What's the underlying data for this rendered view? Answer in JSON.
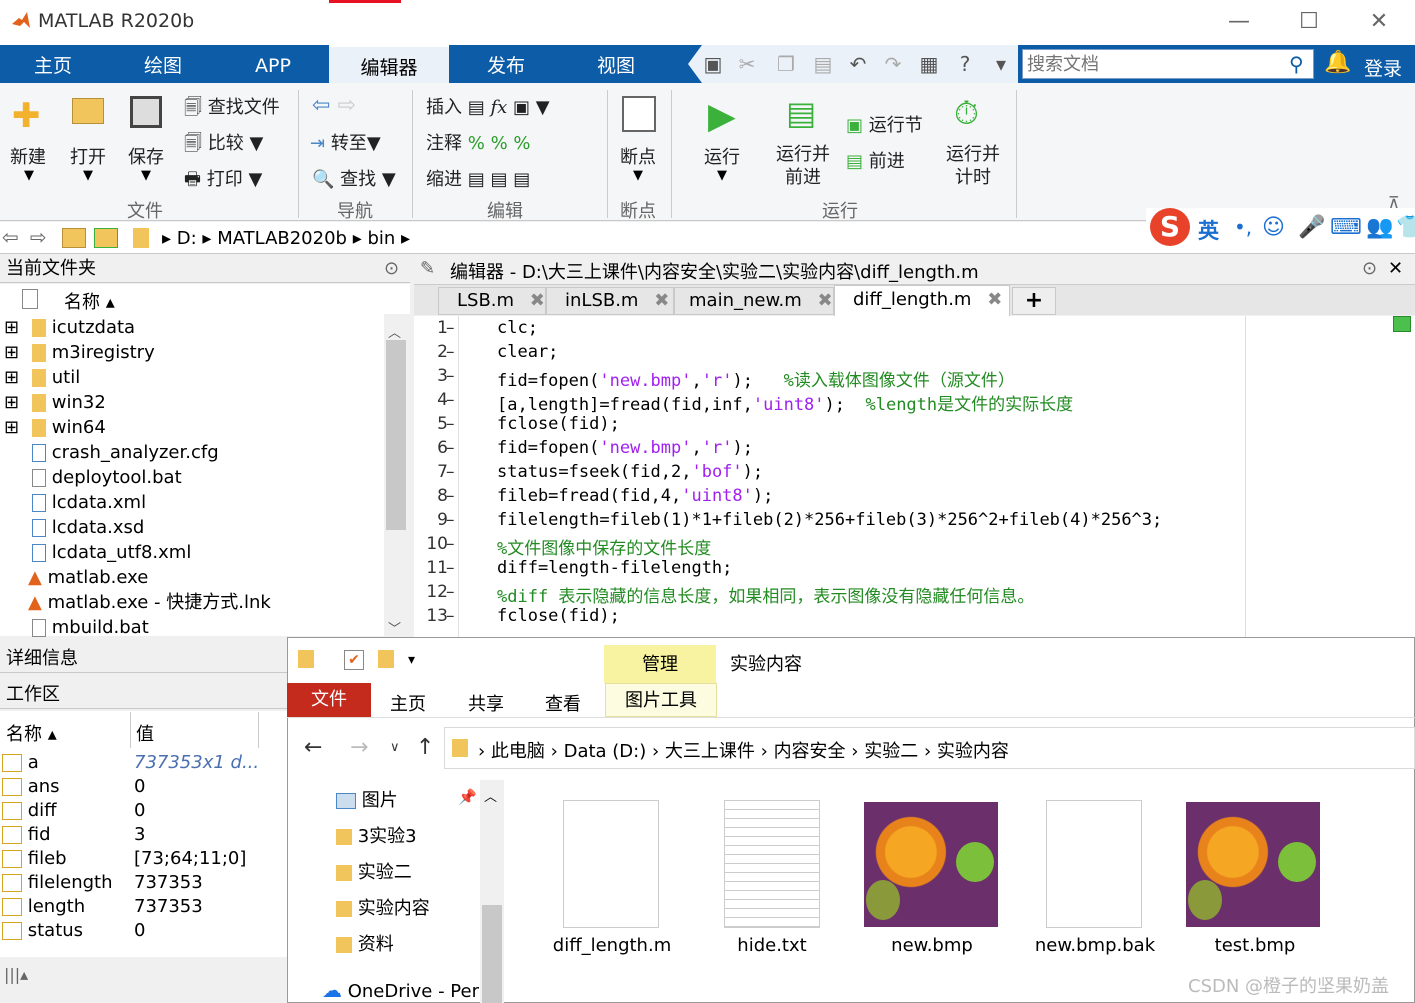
{
  "app": {
    "title": "MATLAB R2020b",
    "min": "—",
    "max": "☐",
    "close": "✕"
  },
  "tabs": [
    "主页",
    "绘图",
    "APP",
    "编辑器",
    "发布",
    "视图"
  ],
  "search": {
    "placeholder": "搜索文档"
  },
  "login": "登录",
  "ribbon": {
    "new": "新建",
    "open": "打开",
    "save": "保存",
    "find_files": "查找文件",
    "compare": "比较",
    "print": "打印",
    "file_group": "文件",
    "goto": "转至",
    "find": "查找",
    "nav_group": "导航",
    "insert": "插入",
    "comment": "注释",
    "indent": "缩进",
    "edit_group": "编辑",
    "breakpoints": "断点",
    "bp_group": "断点",
    "run": "运行",
    "run_advance": "运行并\n前进",
    "run_section": "运行节",
    "advance": "前进",
    "run_time": "运行并\n计时",
    "run_group": "运行"
  },
  "address": {
    "drive": "D:",
    "folder1": "MATLAB2020b",
    "folder2": "bin"
  },
  "ime": {
    "lang": "英",
    "punct": "•,"
  },
  "current_folder": {
    "title": "当前文件夹",
    "col_name": "名称",
    "items": [
      "icutzdata",
      "m3iregistry",
      "util",
      "win32",
      "win64",
      "crash_analyzer.cfg",
      "deploytool.bat",
      "lcdata.xml",
      "lcdata.xsd",
      "lcdata_utf8.xml",
      "matlab.exe",
      "matlab.exe - 快捷方式.lnk",
      "mbuild.bat"
    ]
  },
  "details": {
    "title": "详细信息"
  },
  "workspace": {
    "title": "工作区",
    "col_name": "名称",
    "col_value": "值",
    "rows": [
      {
        "name": "a",
        "value": "737353x1 d..."
      },
      {
        "name": "ans",
        "value": "0"
      },
      {
        "name": "diff",
        "value": "0"
      },
      {
        "name": "fid",
        "value": "3"
      },
      {
        "name": "fileb",
        "value": "[73;64;11;0]"
      },
      {
        "name": "filelength",
        "value": "737353"
      },
      {
        "name": "length",
        "value": "737353"
      },
      {
        "name": "status",
        "value": "0"
      }
    ]
  },
  "editor": {
    "title": "编辑器 - D:\\大三上课件\\内容安全\\实验二\\实验内容\\diff_length.m",
    "tabs": [
      "LSB.m",
      "inLSB.m",
      "main_new.m",
      "diff_length.m"
    ],
    "lines": [
      "1",
      "2",
      "3",
      "4",
      "5",
      "6",
      "7",
      "8",
      "9",
      "10",
      "11",
      "12",
      "13"
    ]
  },
  "explorer": {
    "manage": "管理",
    "title": "实验内容",
    "file_tab": "文件",
    "home": "主页",
    "share": "共享",
    "view": "查看",
    "pic_tools": "图片工具",
    "path": [
      "此电脑",
      "Data (D:)",
      "大三上课件",
      "内容安全",
      "实验二",
      "实验内容"
    ],
    "nav": [
      "图片",
      "3实验3",
      "实验二",
      "实验内容",
      "资料",
      "OneDrive - Per"
    ],
    "files": [
      "diff_length.m",
      "hide.txt",
      "new.bmp",
      "new.bmp.bak",
      "test.bmp"
    ]
  },
  "watermark": "CSDN @橙子的坚果奶盖",
  "colors": {
    "tabbar": "#0c5ca8",
    "string": "#a020f0",
    "comment": "#228b22"
  }
}
